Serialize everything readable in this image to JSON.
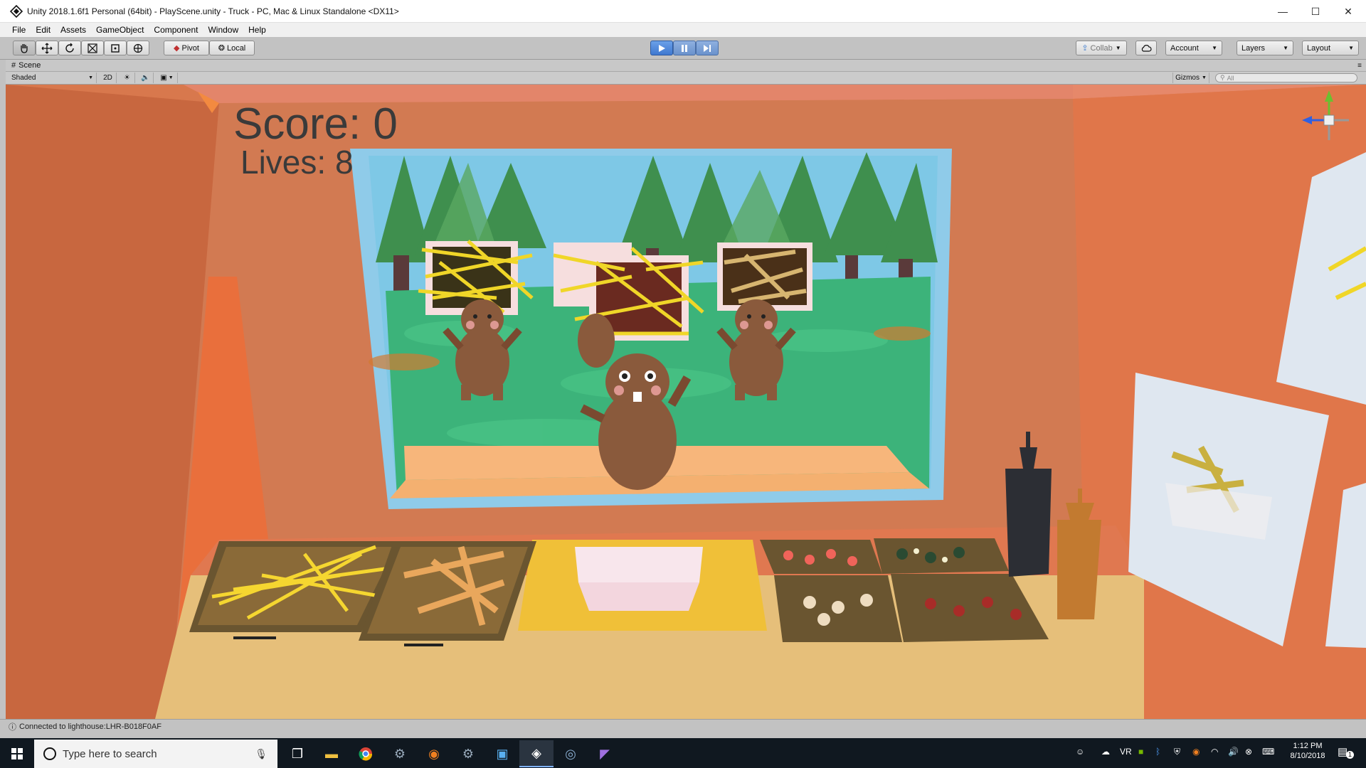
{
  "window": {
    "title": "Unity 2018.1.6f1 Personal (64bit) - PlayScene.unity - Truck - PC, Mac & Linux Standalone <DX11>",
    "controls": {
      "minimize": "—",
      "maximize": "☐",
      "close": "✕"
    }
  },
  "menu": [
    "File",
    "Edit",
    "Assets",
    "GameObject",
    "Component",
    "Window",
    "Help"
  ],
  "toolbar": {
    "pivot": "Pivot",
    "local": "Local",
    "collab": "Collab",
    "account": "Account",
    "layers": "Layers",
    "layout": "Layout"
  },
  "scene": {
    "tab_label": "Scene",
    "shading_mode": "Shaded",
    "mode_2d": "2D",
    "gizmos": "Gizmos",
    "search_placeholder": "All"
  },
  "game": {
    "score": "Score: 0",
    "lives": "Lives: 8"
  },
  "status": "Connected to lighthouse:LHR-B018F0AF",
  "taskbar": {
    "search_placeholder": "Type here to search",
    "time": "1:12 PM",
    "date": "8/10/2018",
    "notification_count": "1"
  },
  "colors": {
    "truck_wall": "#d97a4e",
    "play_button": "#3f78d0",
    "sky": "#78c8ee",
    "grass": "#3cb37a"
  }
}
